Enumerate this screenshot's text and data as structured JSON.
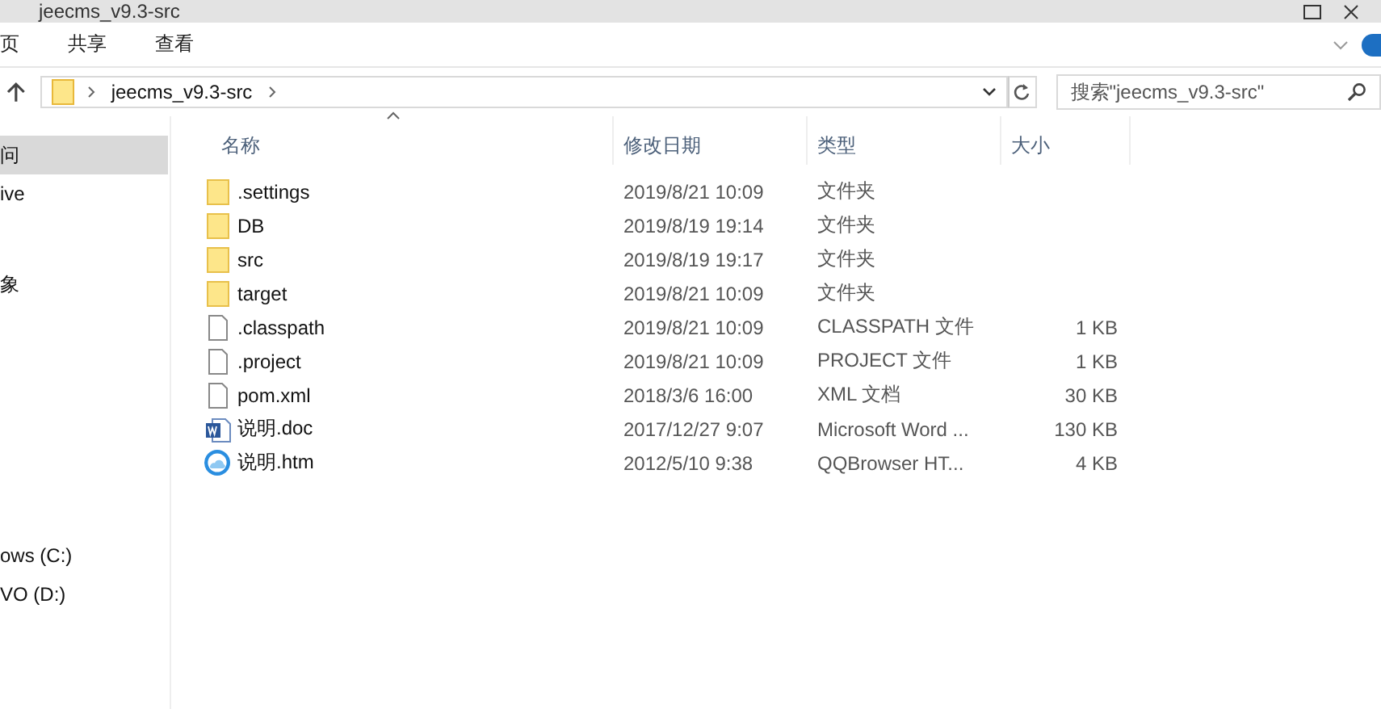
{
  "window": {
    "title": "jeecms_v9.3-src"
  },
  "ribbon_tabs": [
    {
      "label": "页",
      "selected": false
    },
    {
      "label": "共享",
      "selected": false
    },
    {
      "label": "查看",
      "selected": false
    }
  ],
  "address_bar": {
    "path": [
      "jeecms_v9.3-src"
    ]
  },
  "search": {
    "placeholder": "搜索\"jeecms_v9.3-src\""
  },
  "sidebar": {
    "items": [
      {
        "label": "问",
        "selected": true
      },
      {
        "label": "ive",
        "selected": false
      },
      {
        "label": "象",
        "selected": false
      },
      {
        "label": "ows (C:)",
        "selected": false
      },
      {
        "label": "VO (D:)",
        "selected": false
      }
    ]
  },
  "table": {
    "columns": [
      {
        "label": "名称",
        "sorted": true
      },
      {
        "label": "修改日期",
        "sorted": false
      },
      {
        "label": "类型",
        "sorted": false
      },
      {
        "label": "大小",
        "sorted": false
      }
    ],
    "rows": [
      {
        "kind": "folder",
        "name": ".settings",
        "modified": "2019/8/21 10:09",
        "type": "文件夹",
        "size": ""
      },
      {
        "kind": "folder",
        "name": "DB",
        "modified": "2019/8/19 19:14",
        "type": "文件夹",
        "size": ""
      },
      {
        "kind": "folder",
        "name": "src",
        "modified": "2019/8/19 19:17",
        "type": "文件夹",
        "size": ""
      },
      {
        "kind": "folder",
        "name": "target",
        "modified": "2019/8/21 10:09",
        "type": "文件夹",
        "size": ""
      },
      {
        "kind": "file",
        "name": ".classpath",
        "modified": "2019/8/21 10:09",
        "type": "CLASSPATH 文件",
        "size": "1 KB"
      },
      {
        "kind": "file",
        "name": ".project",
        "modified": "2019/8/21 10:09",
        "type": "PROJECT 文件",
        "size": "1 KB"
      },
      {
        "kind": "file",
        "name": "pom.xml",
        "modified": "2018/3/6 16:00",
        "type": "XML 文档",
        "size": "30 KB"
      },
      {
        "kind": "word",
        "name": "说明.doc",
        "modified": "2017/12/27 9:07",
        "type": "Microsoft Word ...",
        "size": "130 KB"
      },
      {
        "kind": "browser",
        "name": "说明.htm",
        "modified": "2012/5/10 9:38",
        "type": "QQBrowser HT...",
        "size": "4 KB"
      }
    ]
  }
}
